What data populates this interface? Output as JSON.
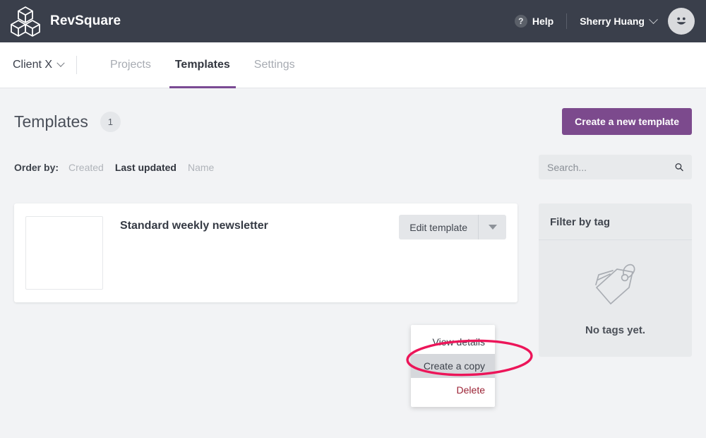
{
  "topbar": {
    "brand_name": "RevSquare",
    "logo_icon": "cubes-logo-icon",
    "help_label": "Help",
    "help_icon": "question-mark-icon",
    "user_name": "Sherry Huang",
    "user_caret_icon": "chevron-down-icon",
    "avatar_icon": "smiley-face-avatar-icon"
  },
  "navbar": {
    "client_label": "Client X",
    "client_caret_icon": "chevron-down-icon",
    "tabs": [
      {
        "label": "Projects",
        "active": false
      },
      {
        "label": "Templates",
        "active": true
      },
      {
        "label": "Settings",
        "active": false
      }
    ]
  },
  "page": {
    "title": "Templates",
    "count": "1",
    "create_button": "Create a new template",
    "order_by_label": "Order by:",
    "order_options": [
      {
        "label": "Created",
        "active": false
      },
      {
        "label": "Last updated",
        "active": true
      },
      {
        "label": "Name",
        "active": false
      }
    ],
    "search": {
      "placeholder": "Search...",
      "value": "",
      "icon": "search-icon"
    }
  },
  "template_card": {
    "name": "Standard weekly newsletter",
    "thumbnail": "empty-template-thumbnail",
    "edit_button": "Edit template",
    "dropdown_arrow_icon": "caret-down-icon"
  },
  "dropdown_menu": {
    "items": [
      {
        "label": "View details",
        "highlighted": false,
        "danger": false
      },
      {
        "label": "Create a copy",
        "highlighted": true,
        "danger": false
      },
      {
        "label": "Delete",
        "highlighted": false,
        "danger": true
      }
    ]
  },
  "tag_panel": {
    "title": "Filter by tag",
    "empty_text": "No tags yet.",
    "empty_icon": "price-tag-icon"
  },
  "annotation": {
    "shape": "ellipse-highlight",
    "target": "Create a copy"
  },
  "colors": {
    "topbar_bg": "#3a3f4b",
    "accent_purple": "#7c4a8d",
    "page_bg": "#f2f3f5",
    "annotation_pink": "#ec1559",
    "danger_red": "#9b2335",
    "panel_gray": "#e8eaec"
  }
}
